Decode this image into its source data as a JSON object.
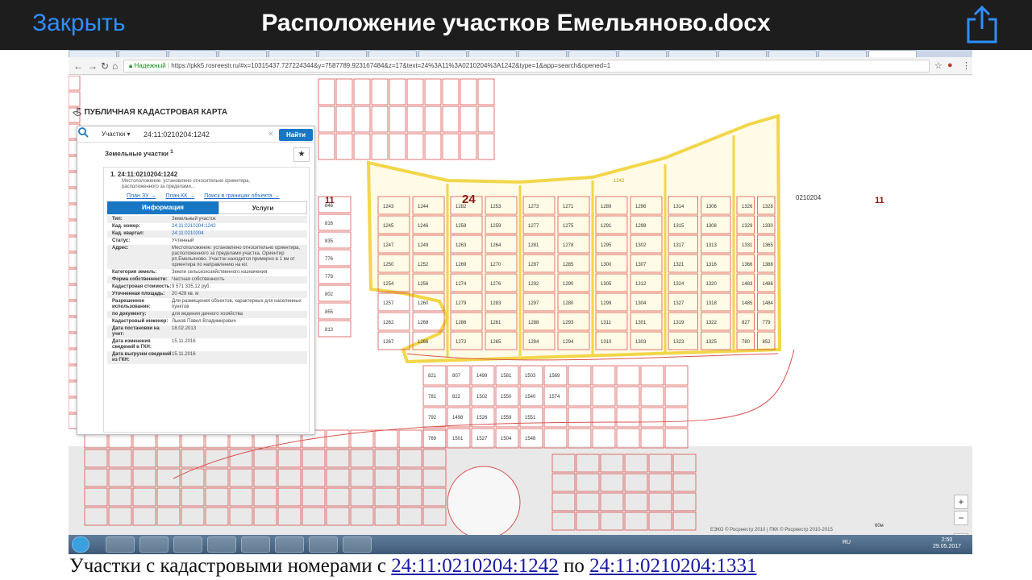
{
  "topbar": {
    "close_label": "Закрыть",
    "title": "Расположение участков Емельяново.docx",
    "share_icon": "share-icon"
  },
  "browser": {
    "secure_label": "Надежный",
    "url": "https://pkk5.rosreestr.ru/#x=10315437.727224344&y=7587789.923167484&z=17&text=24%3A11%3A0210204%3A1242&type=1&app=search&opened=1"
  },
  "pkk": {
    "title": "ПУБЛИЧНАЯ КАДАСТРОВАЯ КАРТА",
    "search_category": "Участки ▾",
    "search_value": "24:11:0210204:1242",
    "search_button": "Найти",
    "section_title": "Земельные участки",
    "section_sup": "1",
    "card_index": "1.",
    "card_number": "24:11:0210204:1242",
    "card_subtitle": "Местоположение: установлено относительно ориентира, расположенного за пределами...",
    "links": [
      "План ЗУ →",
      "План КК →",
      "Поиск в границах объекта →"
    ],
    "tab_info": "Информация",
    "tab_services": "Услуги",
    "properties": [
      {
        "k": "Тип:",
        "v": "Земельный участок",
        "link": false
      },
      {
        "k": "Кад. номер:",
        "v": "24:11:0210204:1242",
        "link": true
      },
      {
        "k": "Кад. квартал:",
        "v": "24:11:0210204",
        "link": true
      },
      {
        "k": "Статус:",
        "v": "Учтенный",
        "link": false
      },
      {
        "k": "Адрес:",
        "v": "Местоположение: установлено относительно ориентира, расположенного за пределами участка. Ориентир рп.Емельяново. Участок находится примерно в 1 км от ориентира по направлению на юг.",
        "link": false
      },
      {
        "k": "Категория земель:",
        "v": "Земли сельскохозяйственного назначения",
        "link": false
      },
      {
        "k": "Форма собственности:",
        "v": "Частная собственность",
        "link": false
      },
      {
        "k": "Кадастровая стоимость:",
        "v": "9 571 335,12 руб.",
        "link": false
      },
      {
        "k": "Уточненная площадь:",
        "v": "20 428 кв. м",
        "link": false
      },
      {
        "k": "Разрешенное использование:",
        "v": "Для размещения объектов, характерных для населенных пунктов",
        "link": false
      },
      {
        "k": "по документу:",
        "v": "для ведения дачного хозяйства",
        "link": false
      },
      {
        "k": "Кадастровый инженер:",
        "v": "Лыков Павел Владимирович",
        "link": false
      },
      {
        "k": "Дата постановки на учет:",
        "v": "18.02.2013",
        "link": false
      },
      {
        "k": "Дата изменения сведений в ГКН:",
        "v": "15.11.2016",
        "link": false
      },
      {
        "k": "Дата выгрузки сведений из ГКН:",
        "v": "15.11.2016",
        "link": false
      }
    ]
  },
  "map": {
    "district_label": "24",
    "quarter_label": "0210204",
    "region_label_right": "11",
    "region_label_left": "11",
    "road_label": "1242",
    "parcels": [
      "1243",
      "1244",
      "1245",
      "1246",
      "1247",
      "1249",
      "1250",
      "1252",
      "1254",
      "1256",
      "1257",
      "1260",
      "1262",
      "1268",
      "1267",
      "1266",
      "1282",
      "1253",
      "1258",
      "1259",
      "1263",
      "1264",
      "1269",
      "1270",
      "1274",
      "1276",
      "1279",
      "1283",
      "1286",
      "1261",
      "1272",
      "1265",
      "1273",
      "1271",
      "1277",
      "1275",
      "1281",
      "1278",
      "1287",
      "1285",
      "1292",
      "1290",
      "1297",
      "1280",
      "1288",
      "1293",
      "1284",
      "1294",
      "1289",
      "1296",
      "1291",
      "1298",
      "1295",
      "1302",
      "1300",
      "1307",
      "1305",
      "1312",
      "1299",
      "1304",
      "1311",
      "1301",
      "1310",
      "1303",
      "1314",
      "1306",
      "1315",
      "1308",
      "1317",
      "1313",
      "1321",
      "1316",
      "1324",
      "1320",
      "1327",
      "1318",
      "1319",
      "1322",
      "1323",
      "1325",
      "1326",
      "1328",
      "1329",
      "1330",
      "1331",
      "1365",
      "1366",
      "1388",
      "1483",
      "1486",
      "1485",
      "1484",
      "827",
      "779",
      "780",
      "852",
      "846",
      "816",
      "835",
      "776",
      "778",
      "802",
      "855",
      "813",
      "821",
      "781",
      "792",
      "769",
      "807",
      "822",
      "1498",
      "1501",
      "1499",
      "1502",
      "1526",
      "1527",
      "1581",
      "1550",
      "1559",
      "1504",
      "1503",
      "1540",
      "1551",
      "1548",
      "1569",
      "1574"
    ],
    "attribution": "ЕЭКО © Росреестр 2010 | ПКК © Росреестр 2010-2015",
    "scale_label": "60м",
    "zoom_in": "+",
    "zoom_out": "−",
    "more": "•••"
  },
  "taskbar": {
    "lang": "RU",
    "time": "2:50",
    "date": "29.05.2017"
  },
  "caption": {
    "prefix": "Участки с кадастровыми номерами с ",
    "from": "24:11:0210204:1242",
    "middle": " по ",
    "to": "24:11:0210204:1331"
  },
  "colors": {
    "accent": "#2f8fff",
    "parcel_line": "#d9534f",
    "highlight": "#f7e26b",
    "button_blue": "#1777c4"
  }
}
